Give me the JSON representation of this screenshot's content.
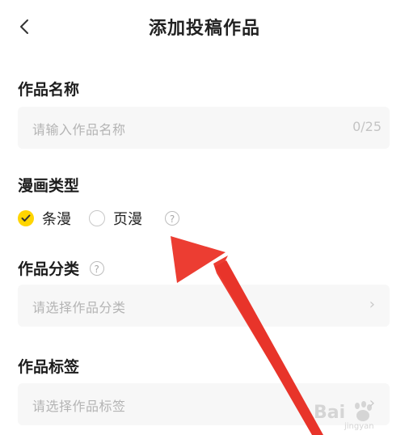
{
  "header": {
    "title": "添加投稿作品"
  },
  "work_name": {
    "label": "作品名称",
    "placeholder": "请输入作品名称",
    "counter": "0/25"
  },
  "comic_type": {
    "label": "漫画类型",
    "options": [
      {
        "label": "条漫",
        "selected": true
      },
      {
        "label": "页漫",
        "selected": false
      }
    ]
  },
  "category": {
    "label": "作品分类",
    "placeholder": "请选择作品分类"
  },
  "tags": {
    "label": "作品标签",
    "placeholder": "请选择作品标签"
  },
  "icons": {
    "back": "chevron-left-icon",
    "help": "question-circle-icon",
    "chevron": "chevron-right-icon"
  },
  "colors": {
    "accent": "#ffd500",
    "annotation_arrow": "#e8342a"
  },
  "watermark": {
    "text": "Bai",
    "sub": "jingyan"
  }
}
